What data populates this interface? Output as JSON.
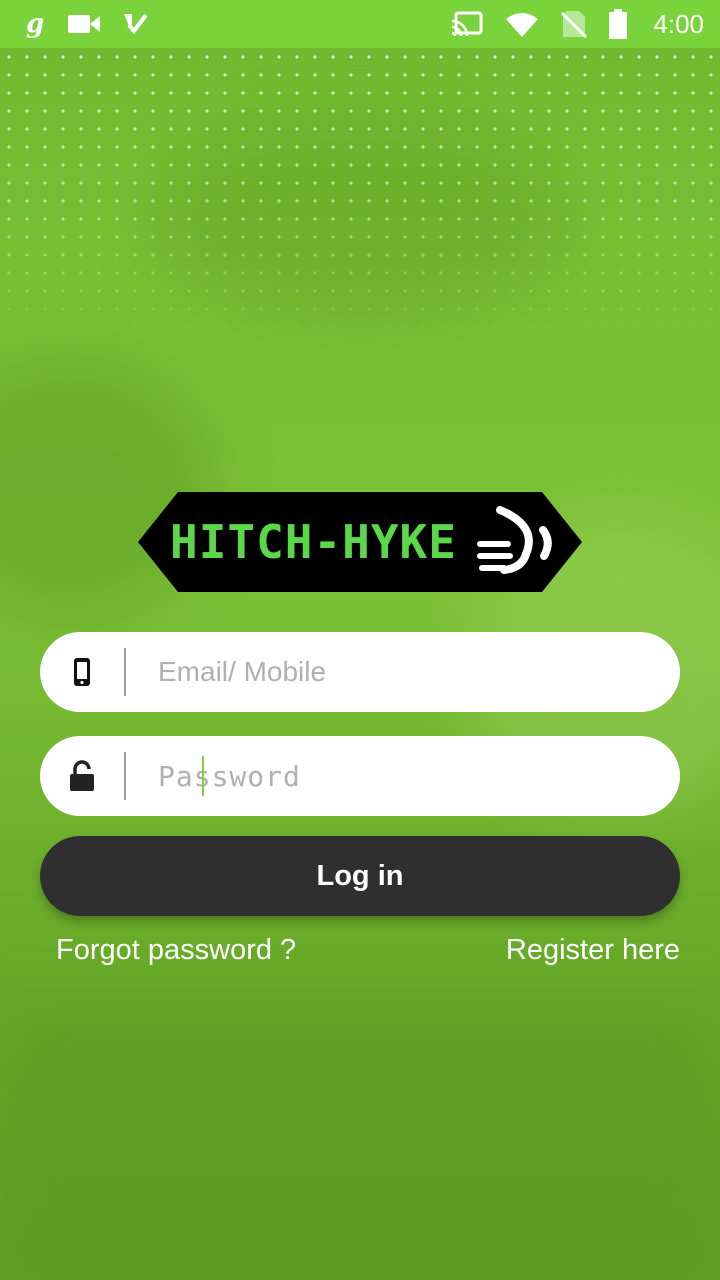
{
  "status_bar": {
    "time": "4:00",
    "icons_left": [
      "goodreads-icon",
      "video-camera-icon",
      "task-check-icon"
    ],
    "icons_right": [
      "cast-icon",
      "wifi-icon",
      "no-sim-icon",
      "battery-icon"
    ]
  },
  "logo": {
    "text": "HITCH-HYKE",
    "background_color": "#000000",
    "text_color": "#5bd84a"
  },
  "login_form": {
    "email": {
      "placeholder": "Email/ Mobile",
      "value": "",
      "icon": "phone-icon"
    },
    "password": {
      "placeholder": "Password",
      "value": "",
      "icon": "unlock-icon"
    },
    "login_label": "Log in",
    "forgot_label": "Forgot password ?",
    "register_label": "Register here"
  },
  "colors": {
    "status_bar": "#7ad33a",
    "background": "#78bf32",
    "button": "#2f2f2f",
    "accent": "#7ad33a"
  }
}
